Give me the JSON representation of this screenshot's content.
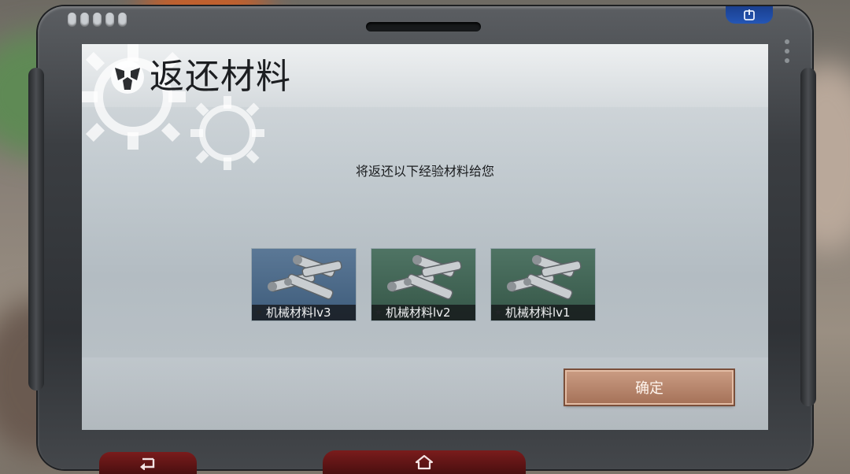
{
  "dialog": {
    "title": "返还材料",
    "message": "将返还以下经验材料给您",
    "items": [
      {
        "label": "机械材料lv3",
        "tier": "blue"
      },
      {
        "label": "机械材料lv2",
        "tier": "green"
      },
      {
        "label": "机械材料lv1",
        "tier": "green"
      }
    ],
    "confirm_label": "确定"
  },
  "icons": {
    "power": "power-icon",
    "back": "back-arrow-icon",
    "home": "home-icon",
    "title": "gear-emblem-icon"
  },
  "colors": {
    "confirm_button": "#b5826a",
    "nav_button": "#6a1a1a",
    "power_button": "#2456b5"
  }
}
